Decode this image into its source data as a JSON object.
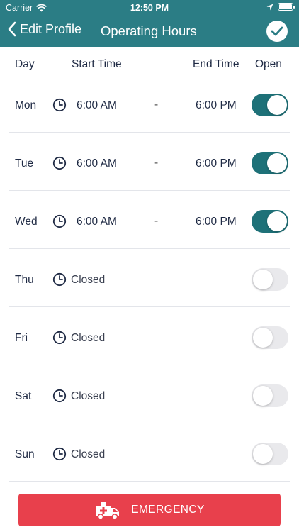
{
  "status_bar": {
    "carrier": "Carrier",
    "time": "12:50 PM"
  },
  "nav": {
    "back_label": "Edit Profile",
    "title": "Operating Hours"
  },
  "table": {
    "headers": {
      "day": "Day",
      "start": "Start Time",
      "end": "End Time",
      "open": "Open"
    },
    "rows": [
      {
        "day": "Mon",
        "start": "6:00 AM",
        "separator": "-",
        "end": "6:00 PM",
        "open": true
      },
      {
        "day": "Tue",
        "start": "6:00 AM",
        "separator": "-",
        "end": "6:00 PM",
        "open": true
      },
      {
        "day": "Wed",
        "start": "6:00 AM",
        "separator": "-",
        "end": "6:00 PM",
        "open": true
      },
      {
        "day": "Thu",
        "status": "Closed",
        "open": false
      },
      {
        "day": "Fri",
        "status": "Closed",
        "open": false
      },
      {
        "day": "Sat",
        "status": "Closed",
        "open": false
      },
      {
        "day": "Sun",
        "status": "Closed",
        "open": false
      }
    ]
  },
  "emergency": {
    "label": "EMERGENCY",
    "icon": "ambulance-icon"
  },
  "colors": {
    "nav": "#2b7d85",
    "toggle_on": "#1e7178",
    "toggle_off": "#e9e9ec",
    "emergency": "#e8404c",
    "text": "#1f2a44"
  }
}
